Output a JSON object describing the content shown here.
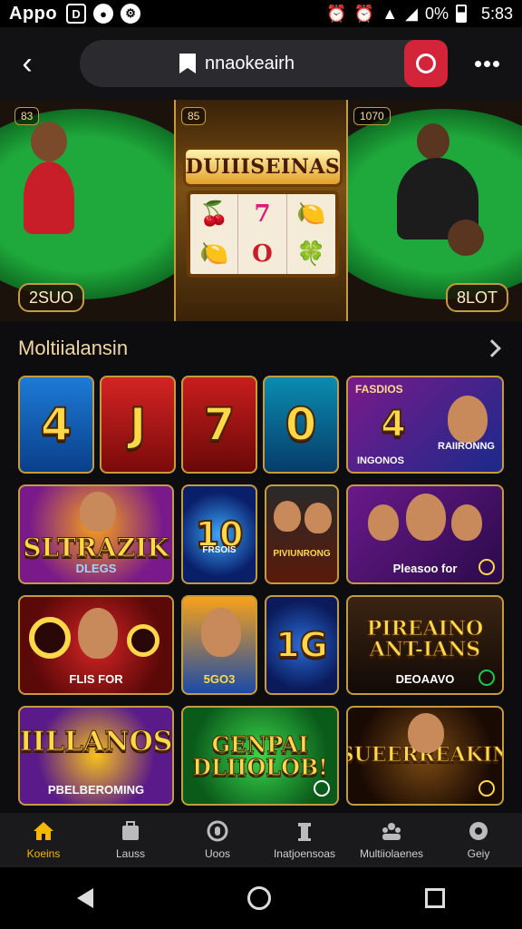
{
  "status_bar": {
    "app_name": "Appo",
    "time": "5:83",
    "battery": "0%"
  },
  "browser": {
    "back_icon": "chevron-left-icon",
    "url": "nnaokeairh",
    "action_color": "#d3243a"
  },
  "hero": {
    "slot_title": "DUIIISEINAS",
    "left_label": "2SUO",
    "right_label": "8LOT",
    "left_badge": "83",
    "center_badge": "85",
    "right_badge": "1070",
    "reels": [
      "🍒",
      "7",
      "🍋",
      "🍋",
      "O",
      "🍀"
    ]
  },
  "section": {
    "title": "Moltiialansin"
  },
  "tiles": [
    {
      "text": "4",
      "sub": ""
    },
    {
      "text": "J",
      "sub": ""
    },
    {
      "text": "7",
      "sub": ""
    },
    {
      "text": "0",
      "sub": ""
    },
    {
      "text": "4",
      "top": "FASDIOS",
      "sub": "INGONOS",
      "sub2": "RAIIRONNG"
    },
    {
      "text": "SLTRAZIK",
      "sub": "DLEGS"
    },
    {
      "text": "10",
      "sub": "FRSOIS"
    },
    {
      "text": "",
      "sub": "PIVIUNRONG"
    },
    {
      "text": "",
      "sub": "Pleasoo for"
    },
    {
      "text": "",
      "sub": "FLIS FOR"
    },
    {
      "text": "",
      "sub": "5GO3"
    },
    {
      "text": "1G",
      "sub": ""
    },
    {
      "text": "PIREAINO ANT-IANS",
      "sub": "DEOAAVO"
    },
    {
      "text": "IILLANOS",
      "sub": "PBELBEROMING"
    },
    {
      "text": "GENPAI DLIIOLOB!",
      "sub": ""
    },
    {
      "text": "SUEERREAKIN",
      "sub": ""
    }
  ],
  "bottom_nav": [
    {
      "label": "Koeins",
      "icon": "home-icon",
      "active": true
    },
    {
      "label": "Lauss",
      "icon": "briefcase-icon",
      "active": false
    },
    {
      "label": "Uoos",
      "icon": "coin-icon",
      "active": false
    },
    {
      "label": "Inatjoensoas",
      "icon": "trophy-icon",
      "active": false
    },
    {
      "label": "Multiiolaenes",
      "icon": "people-icon",
      "active": false
    },
    {
      "label": "Geiy",
      "icon": "gift-icon",
      "active": false
    }
  ]
}
